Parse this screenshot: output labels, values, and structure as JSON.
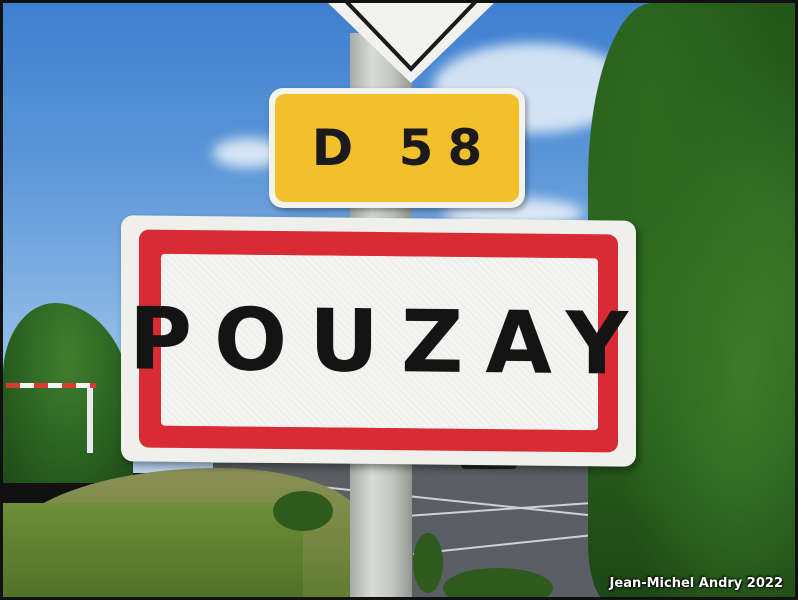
{
  "photo": {
    "subject": "road-signs",
    "colors": {
      "sky": "#5d97d8",
      "town_sign_border": "#d92b34",
      "route_sign_fill": "#f2c02b",
      "foliage": "#2f6a1f"
    }
  },
  "route_sign": {
    "text": "D 58"
  },
  "town_sign": {
    "text": "POUZAY"
  },
  "watermark": {
    "text": "Jean-Michel Andry 2022"
  }
}
